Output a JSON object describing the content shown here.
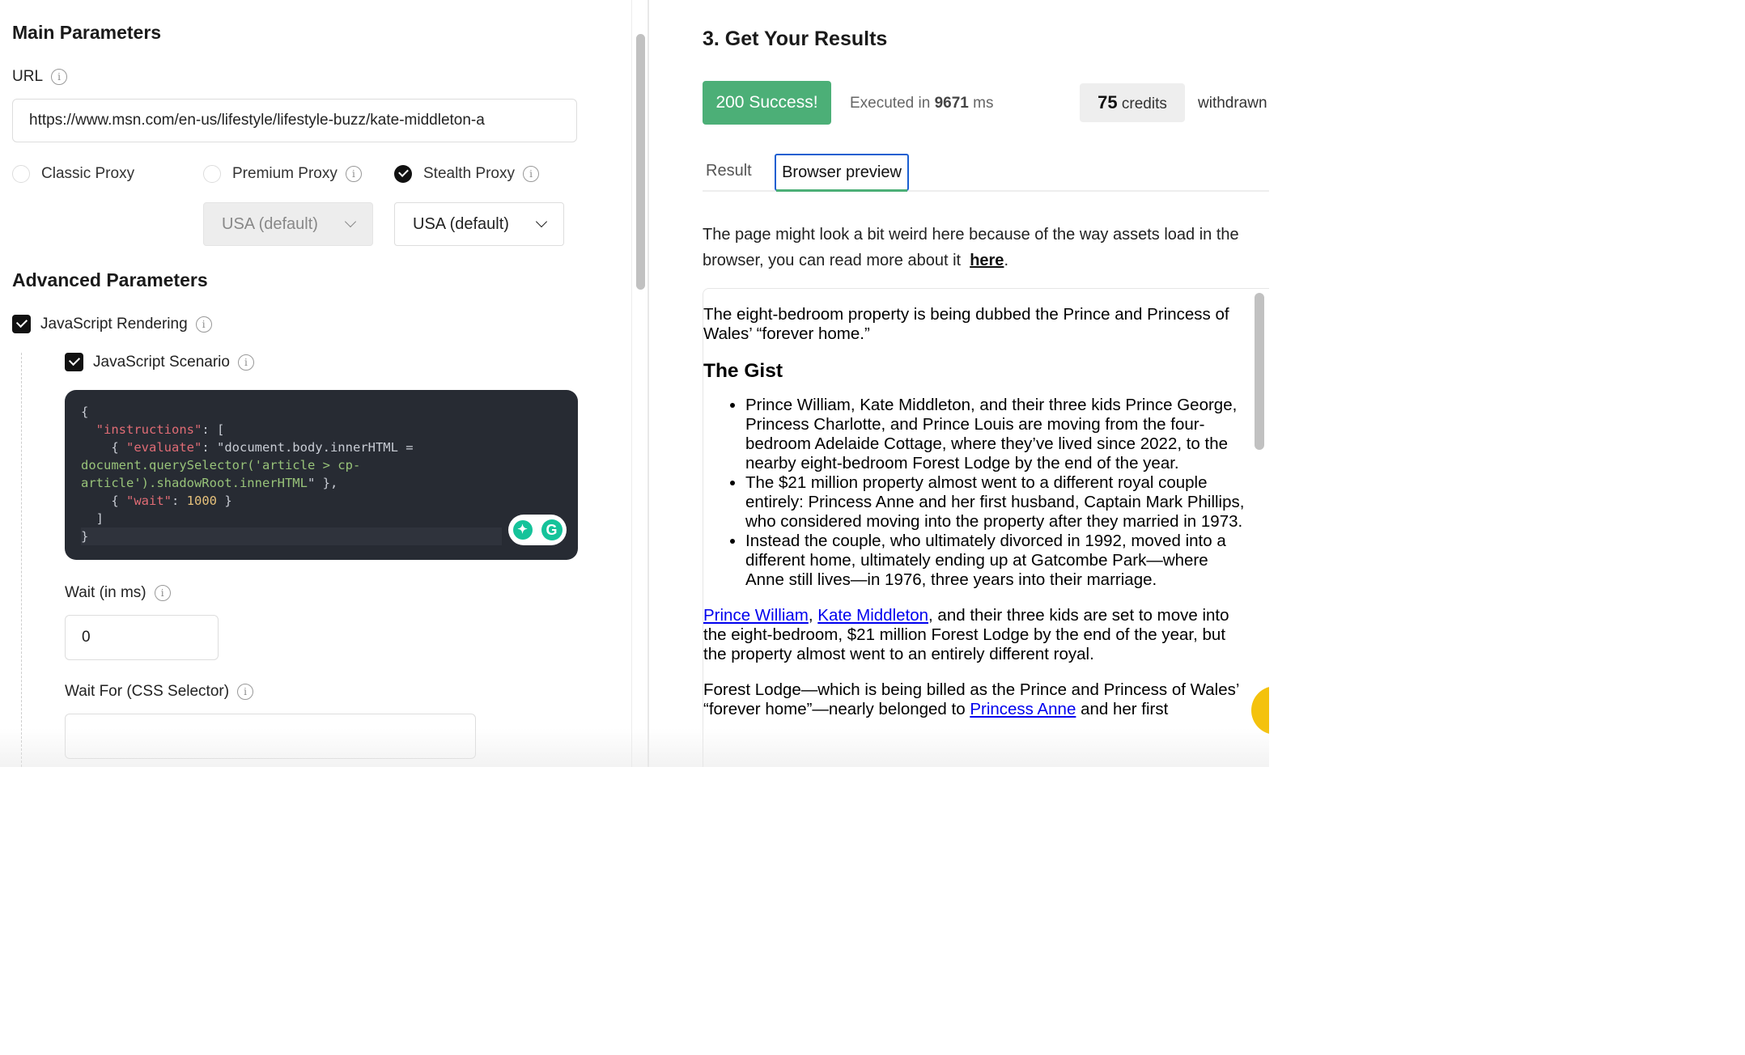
{
  "main_params": {
    "title": "Main Parameters",
    "url_label": "URL",
    "url_value": "https://www.msn.com/en-us/lifestyle/lifestyle-buzz/kate-middleton-a",
    "proxies": [
      {
        "label": "Classic Proxy",
        "selected": false
      },
      {
        "label": "Premium Proxy",
        "selected": false
      },
      {
        "label": "Stealth Proxy",
        "selected": true
      }
    ],
    "premium_country": "USA (default)",
    "stealth_country": "USA (default)"
  },
  "advanced_params": {
    "title": "Advanced Parameters",
    "js_rendering_label": "JavaScript Rendering",
    "js_scenario_label": "JavaScript Scenario",
    "code_lines": [
      "{",
      "  \"instructions\": [",
      "    { \"evaluate\": \"document.body.innerHTML =",
      "document.querySelector('article > cp-",
      "article').shadowRoot.innerHTML\" },",
      "    { \"wait\": 1000 }",
      "  ]",
      "}"
    ],
    "wait_label": "Wait (in ms)",
    "wait_value": "0",
    "wait_for_label": "Wait For (CSS Selector)",
    "wait_for_value": ""
  },
  "results": {
    "title": "3. Get Your Results",
    "status": "200 Success!",
    "exec_prefix": "Executed in",
    "exec_ms": "9671",
    "exec_unit": "ms",
    "credits_value": "75",
    "credits_label": "credits",
    "withdrawn": "withdrawn",
    "tabs": [
      "Result",
      "Browser preview"
    ],
    "note": "The page might look a bit weird here because of the way assets load in the browser, you can read more about it",
    "note_link": "here",
    "status_color": "#4caf77"
  },
  "preview": {
    "intro": "The eight-bedroom property is being dubbed the Prince and Princess of Wales’ “forever home.”",
    "heading": "The Gist",
    "bullets": [
      "Prince William, Kate Middleton, and their three kids Prince George, Princess Charlotte, and Prince Louis are moving from the four-bedroom Adelaide Cottage, where they’ve lived since 2022, to the nearby eight-bedroom Forest Lodge by the end of the year.",
      "The $21 million property almost went to a different royal couple entirely: Princess Anne and her first husband, Captain Mark Phillips, who considered moving into the property after they married in 1973.",
      "Instead the couple, who ultimately divorced in 1992, moved into a different home, ultimately ending up at Gatcombe Park—where Anne still lives—in 1976, three years into their marriage."
    ],
    "p2_link1": "Prince William",
    "p2_sep": ", ",
    "p2_link2": "Kate Middleton",
    "p2_rest": ", and their three kids are set to move into the eight-bedroom, $21 million Forest Lodge by the end of the year, but the property almost went to an entirely different royal.",
    "p3_start": "Forest Lodge—which is being billed as the Prince and Princess of Wales’ “forever home”—nearly belonged to ",
    "p3_link": "Princess Anne",
    "p3_end": " and her first"
  }
}
